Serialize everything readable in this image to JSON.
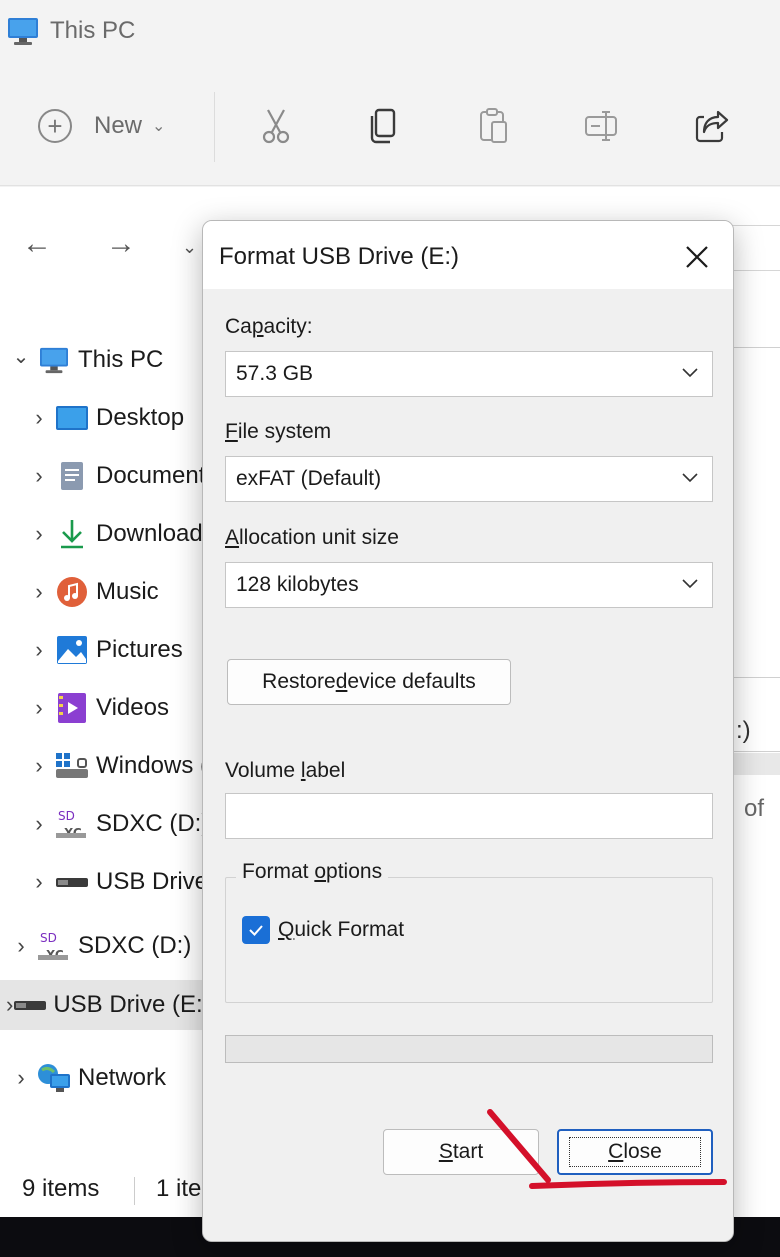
{
  "window": {
    "title": "This PC"
  },
  "toolbar": {
    "new_label": "New",
    "buttons": [
      {
        "name": "cut-icon"
      },
      {
        "name": "copy-icon"
      },
      {
        "name": "paste-icon"
      },
      {
        "name": "rename-icon"
      },
      {
        "name": "share-icon"
      }
    ]
  },
  "nav": {
    "items": [
      {
        "label": "This PC",
        "icon": "computer-icon",
        "indent": 0,
        "expanded": true
      },
      {
        "label": "Desktop",
        "icon": "desktop-folder-icon",
        "indent": 1
      },
      {
        "label": "Documents",
        "icon": "documents-icon",
        "indent": 1
      },
      {
        "label": "Downloads",
        "icon": "download-icon",
        "indent": 1
      },
      {
        "label": "Music",
        "icon": "music-icon",
        "indent": 1
      },
      {
        "label": "Pictures",
        "icon": "pictures-icon",
        "indent": 1
      },
      {
        "label": "Videos",
        "icon": "videos-icon",
        "indent": 1
      },
      {
        "label": "Windows (C:)",
        "icon": "windows-drive-icon",
        "indent": 1
      },
      {
        "label": "SDXC (D:)",
        "icon": "sd-card-icon",
        "indent": 1
      },
      {
        "label": "USB Drive (E:)",
        "icon": "usb-drive-icon",
        "indent": 1
      },
      {
        "label": "SDXC (D:)",
        "icon": "sd-card-icon",
        "indent": 0
      },
      {
        "label": "USB Drive (E:)",
        "icon": "usb-drive-icon",
        "indent": 0,
        "selected": true
      },
      {
        "label": "Network",
        "icon": "network-icon",
        "indent": 0
      }
    ]
  },
  "right_fragments": {
    "drive_c": ":)",
    "of_text": "of"
  },
  "status": {
    "items_count": "9 items",
    "selected_count": "1 ite"
  },
  "dialog": {
    "title": "Format USB Drive (E:)",
    "capacity": {
      "label_pre": "Ca",
      "label_u": "p",
      "label_post": "acity:",
      "value": "57.3 GB"
    },
    "file_system": {
      "label_u": "F",
      "label_post": "ile system",
      "value": "exFAT (Default)"
    },
    "allocation": {
      "label_u": "A",
      "label_post": "llocation unit size",
      "value": "128 kilobytes"
    },
    "restore": {
      "pre": "Restore ",
      "u": "d",
      "post": "evice defaults"
    },
    "volume_label": {
      "pre": "Volume ",
      "u": "l",
      "post": "abel",
      "value": ""
    },
    "format_options": {
      "pre": "Format ",
      "u": "o",
      "post": "ptions"
    },
    "quick_format": {
      "u": "Q",
      "post": "uick Format",
      "checked": true
    },
    "start": {
      "u": "S",
      "post": "tart"
    },
    "close": {
      "u": "C",
      "post": "lose"
    }
  },
  "colors": {
    "accent": "#1a6fd6",
    "annotation": "#d4102a"
  }
}
